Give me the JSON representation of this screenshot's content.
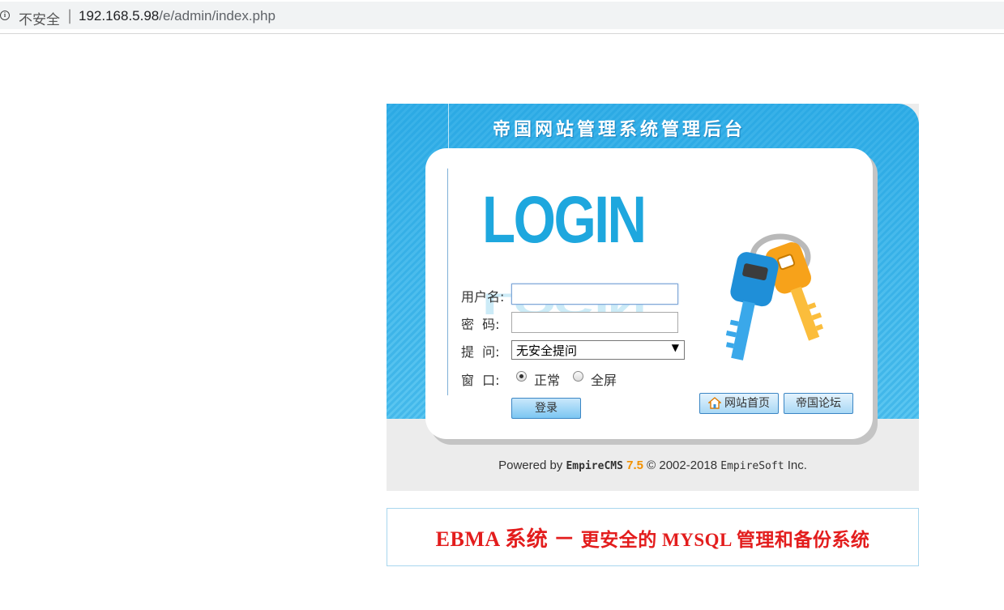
{
  "browser": {
    "security_label": "不安全",
    "separator": "|",
    "url_host": "192.168.5.98",
    "url_path": "/e/admin/index.php"
  },
  "login": {
    "title": "帝国网站管理系统管理后台",
    "logo_text": "LOGIN",
    "username_label": "用户名:",
    "username_value": "",
    "password_label": "密  码:",
    "password_value": "",
    "question_label": "提  问:",
    "question_selected": "无安全提问",
    "window_label": "窗  口:",
    "window_options": [
      "正常",
      "全屏"
    ],
    "window_selected": "正常",
    "submit_label": "登录",
    "home_link_label": "网站首页",
    "forum_link_label": "帝国论坛"
  },
  "footer": {
    "powered_prefix": "Powered by",
    "brand": "EmpireCMS",
    "version": "7.5",
    "copyright": "© 2002-2018",
    "company": "EmpireSoft",
    "suffix": "Inc."
  },
  "banner": {
    "left": "EBMA 系统",
    "dash": "－",
    "right": "更安全的 MYSQL 管理和备份系统"
  },
  "colors": {
    "accent_blue": "#1ea7de",
    "banner_red": "#e31d1d",
    "version_orange": "#f29100"
  }
}
